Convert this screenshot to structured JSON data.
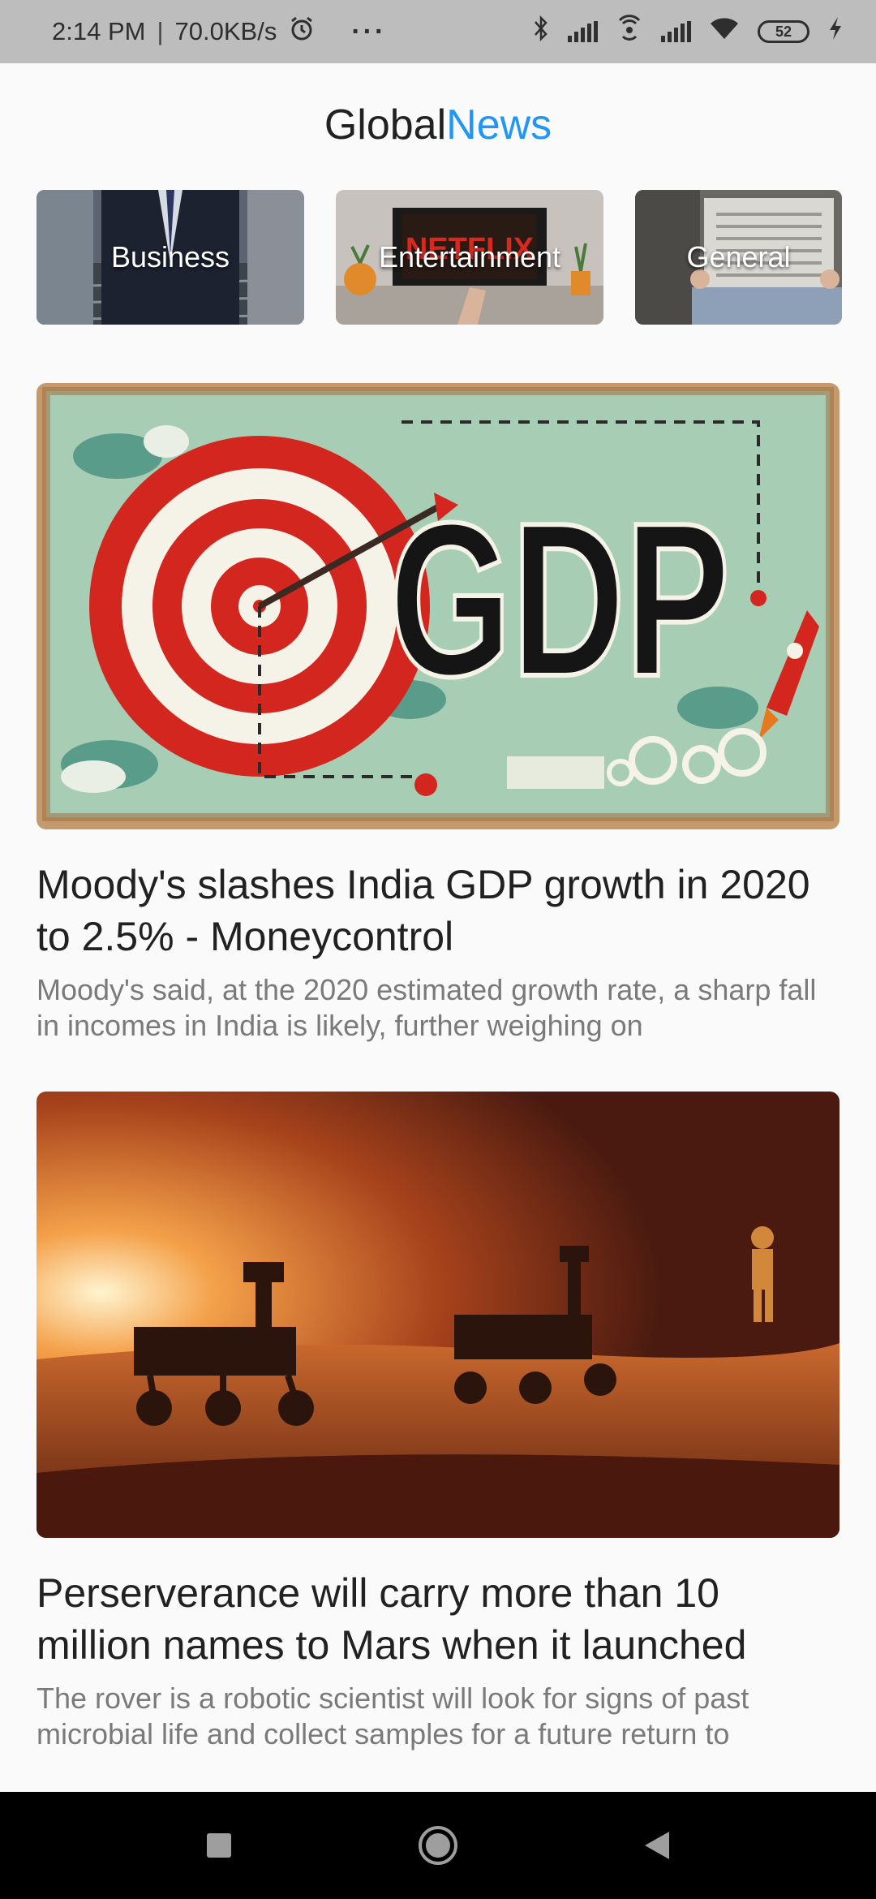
{
  "status_bar": {
    "time": "2:14 PM",
    "separator": "|",
    "speed": "70.0KB/s",
    "more": "···",
    "battery": "52",
    "icons": [
      "alarm-icon",
      "bluetooth-icon",
      "signal-icon",
      "hotspot-icon",
      "signal-icon",
      "wifi-icon",
      "battery-icon",
      "charging-icon"
    ]
  },
  "header": {
    "title_part1": "Global",
    "title_part2": "News",
    "accent_color": "#2196f3"
  },
  "categories": [
    {
      "label": "Business"
    },
    {
      "label": "Entertainment"
    },
    {
      "label": "General"
    }
  ],
  "articles": [
    {
      "title": "Moody's slashes India GDP growth in 2020 to 2.5% - Moneycontrol",
      "description": "Moody's said, at the 2020 estimated growth rate, a sharp fall in incomes in India is likely, further weighing on",
      "image_text": "GDP"
    },
    {
      "title": "Perserverance will carry more than 10 million names to Mars when it launched",
      "description": "The rover is a robotic scientist will look for signs of past microbial life and collect samples for a future return to"
    }
  ],
  "nav": {
    "icons": [
      "recents-icon",
      "home-icon",
      "back-icon"
    ]
  }
}
